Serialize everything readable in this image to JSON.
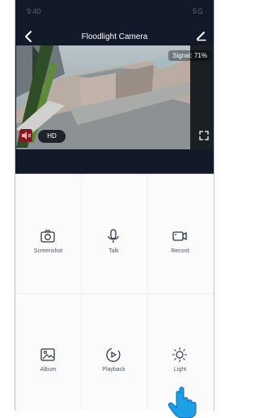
{
  "status_bar": {
    "time": "9:40",
    "signal_text": "5G"
  },
  "header": {
    "title": "Floodlight Camera"
  },
  "video": {
    "signal_label": "Signal: 71%",
    "quality_label": "HD"
  },
  "controls": {
    "row1": [
      {
        "label": "Screenshot",
        "icon": "camera-icon"
      },
      {
        "label": "Talk",
        "icon": "microphone-icon"
      },
      {
        "label": "Record",
        "icon": "video-record-icon"
      }
    ],
    "row2": [
      {
        "label": "Album",
        "icon": "image-icon"
      },
      {
        "label": "Playback",
        "icon": "playback-icon"
      },
      {
        "label": "Light",
        "icon": "light-icon"
      }
    ]
  },
  "colors": {
    "background": "#121a2a",
    "accent": "#1ea0e8"
  }
}
